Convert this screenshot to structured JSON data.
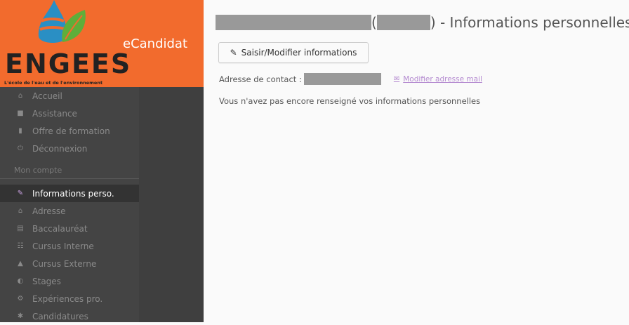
{
  "brand": {
    "app_name": "eCandidat",
    "logo_text": "ENGEES",
    "logo_subtitle": "L'école de l'eau et de l'environnement"
  },
  "sidebar": {
    "items": [
      {
        "label": "Accueil",
        "icon": "home-icon"
      },
      {
        "label": "Assistance",
        "icon": "support-icon"
      },
      {
        "label": "Offre de formation",
        "icon": "bookmark-icon"
      },
      {
        "label": "Déconnexion",
        "icon": "power-icon"
      }
    ],
    "section_title": "Mon compte",
    "account_items": [
      {
        "label": "Informations perso.",
        "icon": "pencil-icon",
        "active": true
      },
      {
        "label": "Adresse",
        "icon": "home-icon"
      },
      {
        "label": "Baccalauréat",
        "icon": "book-icon"
      },
      {
        "label": "Cursus Interne",
        "icon": "institution-icon"
      },
      {
        "label": "Cursus Externe",
        "icon": "graduation-cap-icon"
      },
      {
        "label": "Stages",
        "icon": "briefcase-icon"
      },
      {
        "label": "Expériences pro.",
        "icon": "cogs-icon"
      },
      {
        "label": "Candidatures",
        "icon": "asterisk-icon"
      }
    ]
  },
  "main": {
    "title_open_paren": "(",
    "title_suffix": ") - Informations personnelles",
    "edit_button_label": "Saisir/Modifier informations",
    "contact_label": "Adresse de contact :",
    "modify_mail_label": "Modifier adresse mail",
    "empty_message": "Vous n'avez pas encore renseigné vos informations personnelles"
  },
  "colors": {
    "brand_orange": "#f26b2d",
    "sidebar_bg": "#444444",
    "active_item_bg": "#333333",
    "link_purple": "#b48ad0"
  }
}
